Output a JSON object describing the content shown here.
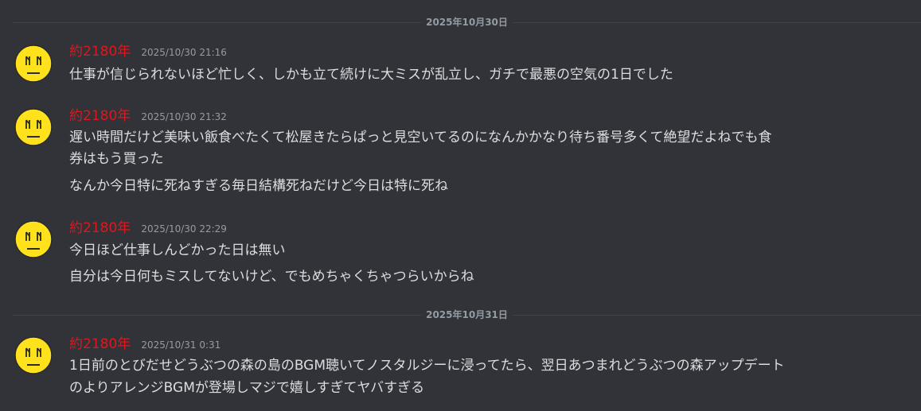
{
  "dividers": [
    {
      "label": "2025年10月30日"
    },
    {
      "label": "2025年10月31日"
    }
  ],
  "messages": [
    {
      "username": "約2180年",
      "timestamp": "2025/10/30 21:16",
      "lines": [
        "仕事が信じられないほど忙しく、しかも立て続けに大ミスが乱立し、ガチで最悪の空気の1日でした"
      ]
    },
    {
      "username": "約2180年",
      "timestamp": "2025/10/30 21:32",
      "lines": [
        "遅い時間だけど美味い飯食べたくて松屋きたらぱっと見空いてるのになんかかなり待ち番号多くて絶望だよねでも食",
        "券はもう買った",
        "なんか今日特に死ねすぎる毎日結構死ねだけど今日は特に死ね"
      ]
    },
    {
      "username": "約2180年",
      "timestamp": "2025/10/30 22:29",
      "lines": [
        "今日ほど仕事しんどかった日は無い",
        "自分は今日何もミスしてないけど、でもめちゃくちゃつらいからね"
      ]
    },
    {
      "username": "約2180年",
      "timestamp": "2025/10/31 0:31",
      "lines": [
        "1日前のとびだせどうぶつの森の島のBGM聴いてノスタルジーに浸ってたら、翌日あつまれどうぶつの森アップデート",
        "のよりアレンジBGMが登場しマジで嬉しすぎてヤバすぎる"
      ]
    }
  ],
  "colors": {
    "background": "#313338",
    "username": "#e0161d",
    "text": "#dbdee1",
    "muted": "#949ba4",
    "avatar_fill": "#ffe21c"
  }
}
